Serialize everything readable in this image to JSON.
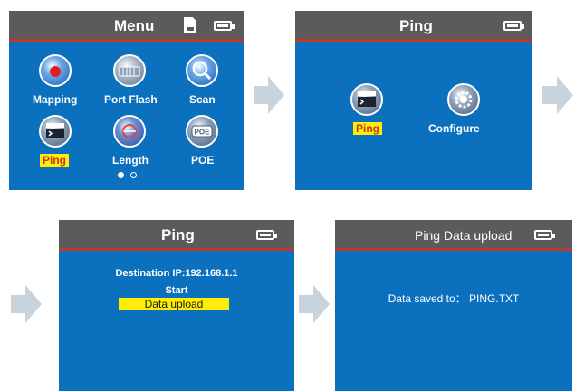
{
  "screen1": {
    "title": "Menu",
    "items": [
      {
        "label": "Mapping"
      },
      {
        "label": "Port Flash"
      },
      {
        "label": "Scan"
      },
      {
        "label": "Ping"
      },
      {
        "label": "Length"
      },
      {
        "label": "POE"
      }
    ],
    "selected": "Ping",
    "page_indicator": {
      "current": 1,
      "total": 2
    }
  },
  "screen2": {
    "title": "Ping",
    "items": [
      {
        "label": "Ping"
      },
      {
        "label": "Configure"
      }
    ],
    "selected": "Ping"
  },
  "screen3": {
    "title": "Ping",
    "destination": "Destination IP:192.168.1.1",
    "start": "Start",
    "data_upload": "Data  upload",
    "selected": "Data  upload"
  },
  "screen4": {
    "title": "Ping Data upload",
    "message": "Data  saved  to： PING.TXT"
  },
  "colors": {
    "screen_bg": "#0b70bd",
    "titlebar": "#5b5b5b",
    "title_border": "#c0392b",
    "highlight": "#ffee00",
    "arrow": "#c9d3dc"
  },
  "icons": [
    "mapping-icon",
    "port-flash-icon",
    "scan-icon",
    "ping-icon",
    "length-icon",
    "poe-icon",
    "configure-icon",
    "arrow-right-icon",
    "battery-icon",
    "sd-card-icon"
  ]
}
